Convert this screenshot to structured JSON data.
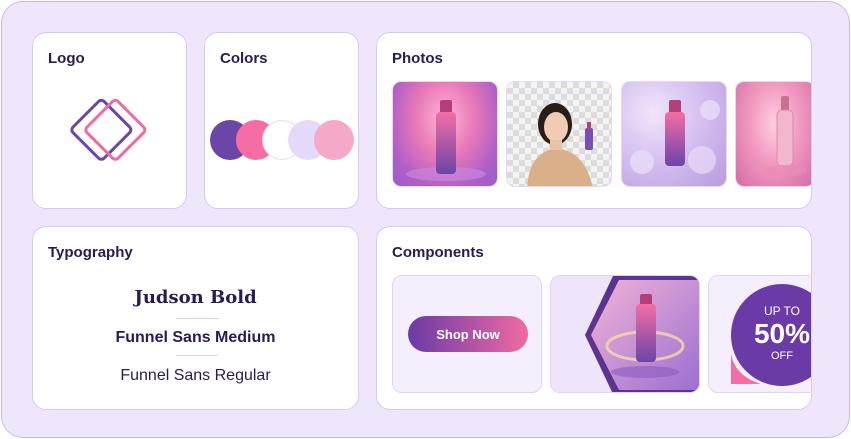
{
  "logo": {
    "title": "Logo"
  },
  "colors": {
    "title": "Colors",
    "swatches": [
      "#6b45a8",
      "#f46ea4",
      "#ffffff",
      "#e4d9fb",
      "#f5a9c8"
    ]
  },
  "photos": {
    "title": "Photos"
  },
  "typography": {
    "title": "Typography",
    "samples": [
      "Judson Bold",
      "Funnel Sans Medium",
      "Funnel Sans Regular"
    ]
  },
  "components": {
    "title": "Components",
    "button_label": "Shop Now",
    "badge": {
      "line1": "UP TO",
      "value": "50%",
      "line2": "OFF"
    }
  }
}
